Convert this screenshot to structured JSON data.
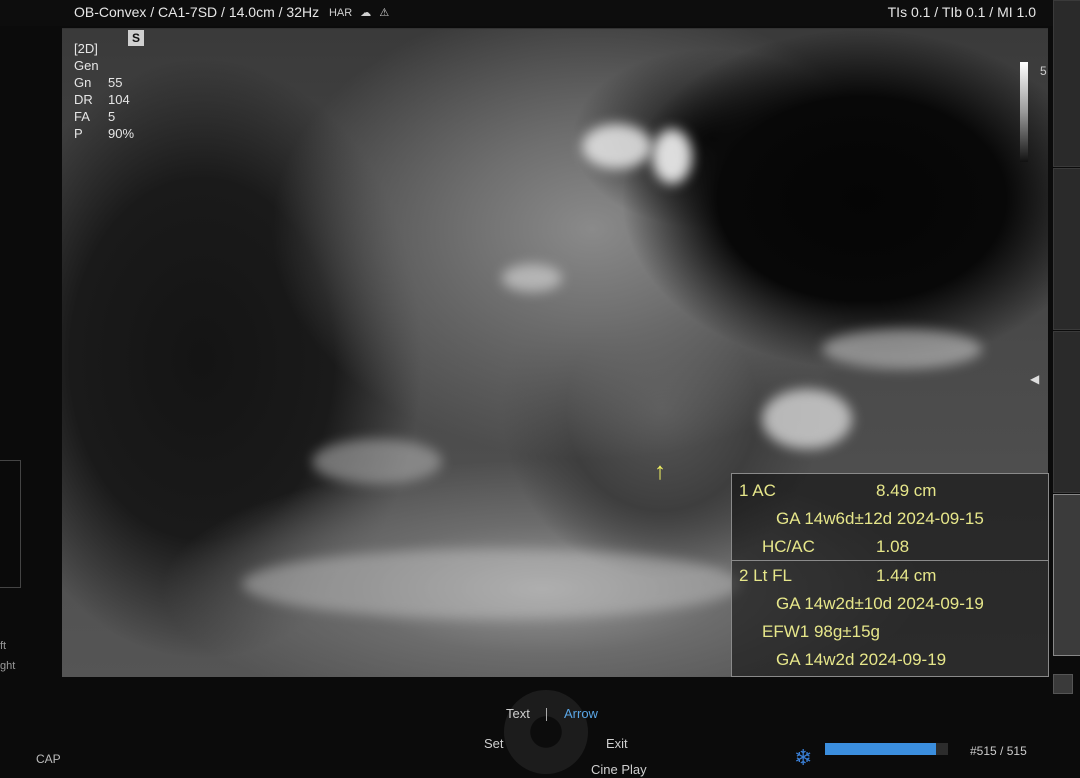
{
  "header": {
    "probe_info": "OB-Convex / CA1-7SD / 14.0cm / 32Hz",
    "icons": [
      "har-icon",
      "shield-icon",
      "signal-icon"
    ],
    "har_label": "HAR",
    "safety": "TIs 0.1 / TIb 0.1 / MI 1.0"
  },
  "params": {
    "mode": "[2D]",
    "preset": "Gen",
    "rows": [
      {
        "k": "Gn",
        "v": "55"
      },
      {
        "k": "DR",
        "v": "104"
      },
      {
        "k": "FA",
        "v": "5"
      },
      {
        "k": "P",
        "v": "90%"
      }
    ],
    "badge": "S"
  },
  "measurements": {
    "line1": "1  AC",
    "line1_val": "8.49 cm",
    "line2": "GA  14w6d±12d  2024-09-15",
    "line3": "HC/AC",
    "line3_val": "1.08",
    "line4": "2  Lt FL",
    "line4_val": "1.44 cm",
    "line5": "GA  14w2d±10d  2024-09-19",
    "line6": "EFW1   98g±15g",
    "line7": "GA  14w2d  2024-09-19"
  },
  "scale": {
    "label": "5"
  },
  "side_labels": {
    "left_top": "ft",
    "left_bottom": "ght"
  },
  "bottom": {
    "cap": "CAP",
    "text_label": "Text",
    "arrow_label": "Arrow",
    "set_label": "Set",
    "exit_label": "Exit",
    "cine_label": "Cine Play",
    "frame_counter": "#515",
    "frame_total": "/ 515",
    "cine_progress": 0.9
  },
  "colors": {
    "measure_text": "#e6e68a",
    "arrow_active": "#5aa6e6",
    "freeze_icon": "#3a7fd5"
  }
}
